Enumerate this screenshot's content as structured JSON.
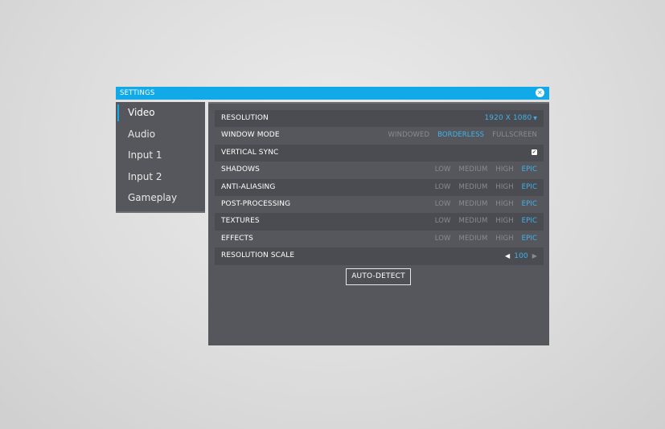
{
  "window": {
    "title": "SETTINGS"
  },
  "sidebar": {
    "items": [
      {
        "label": "Video",
        "active": true
      },
      {
        "label": "Audio",
        "active": false
      },
      {
        "label": "Input 1",
        "active": false
      },
      {
        "label": "Input 2",
        "active": false
      },
      {
        "label": "Gameplay",
        "active": false
      }
    ]
  },
  "video": {
    "resolution": {
      "label": "RESOLUTION",
      "value": "1920 X 1080",
      "icon": "chevron-down-icon"
    },
    "window_mode": {
      "label": "WINDOW MODE",
      "options": [
        "WINDOWED",
        "BORDERLESS",
        "FULLSCREEN"
      ],
      "selected": "BORDERLESS"
    },
    "vsync": {
      "label": "VERTICAL SYNC",
      "checked": true
    },
    "quality_options": [
      "LOW",
      "MEDIUM",
      "HIGH",
      "EPIC"
    ],
    "quality_rows": [
      {
        "label": "SHADOWS",
        "selected": "EPIC"
      },
      {
        "label": "ANTI-ALIASING",
        "selected": "EPIC"
      },
      {
        "label": "POST-PROCESSING",
        "selected": "EPIC"
      },
      {
        "label": "TEXTURES",
        "selected": "EPIC"
      },
      {
        "label": "EFFECTS",
        "selected": "EPIC"
      }
    ],
    "resolution_scale": {
      "label": "RESOLUTION SCALE",
      "value": "100"
    },
    "auto_detect_label": "AUTO-DETECT"
  },
  "colors": {
    "accent": "#12a9e9",
    "selected_option": "#3fb3ec",
    "panel": "#56575c",
    "row_alt": "#4b4c51",
    "inactive_option": "#8a8b8f"
  }
}
